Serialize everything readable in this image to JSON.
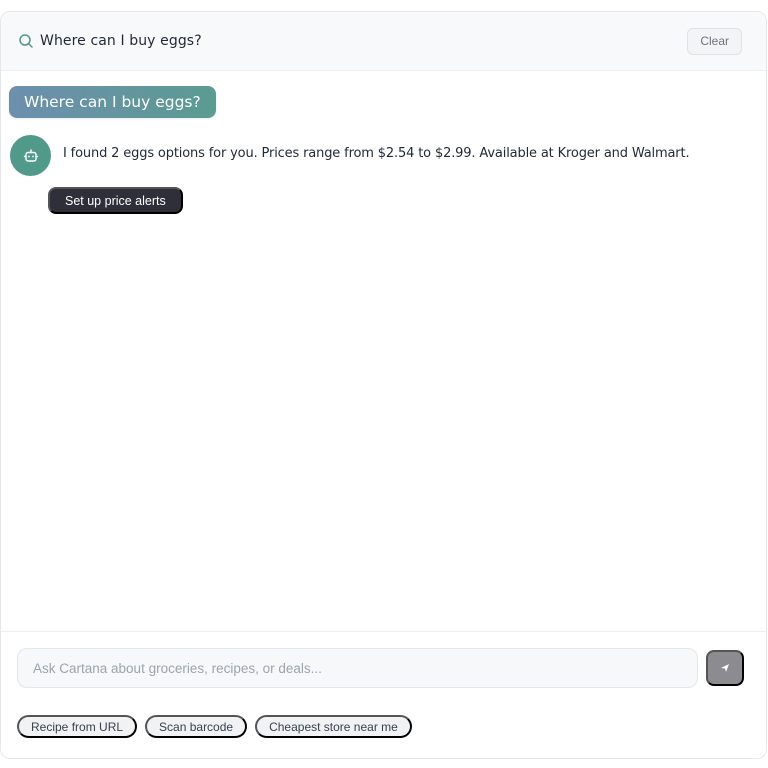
{
  "header": {
    "query": "Where can I buy eggs?",
    "clear_label": "Clear"
  },
  "conversation": {
    "user_message": "Where can I buy eggs?",
    "bot_message": "I found 2 eggs options for you. Prices range from $2.54 to $2.99. Available at Kroger and Walmart.",
    "action_label": "Set up price alerts"
  },
  "composer": {
    "placeholder": "Ask Cartana about groceries, recipes, or deals...",
    "value": ""
  },
  "suggestions": [
    "Recipe from URL",
    "Scan barcode",
    "Cheapest store near me"
  ],
  "icons": {
    "search": "search-icon",
    "bot": "bot-icon",
    "send": "send-icon"
  },
  "colors": {
    "accent": "#4f9a89",
    "user_bubble_start": "#6d8fae",
    "user_bubble_end": "#5b9b92",
    "action_chip": "#2f2f3a",
    "send_button": "#8c8c90"
  }
}
